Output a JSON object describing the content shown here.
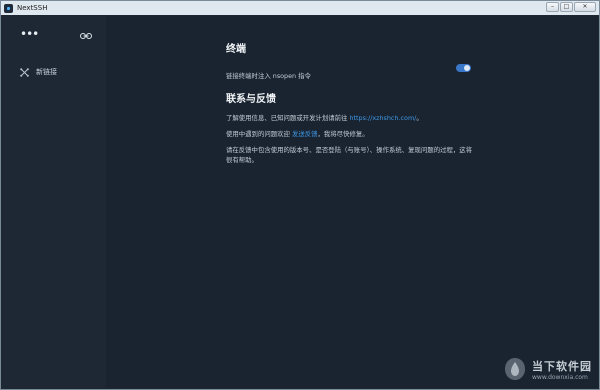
{
  "window": {
    "title": "NextSSH",
    "controls": {
      "minimize": "–",
      "maximize": "□",
      "close": "✕"
    }
  },
  "sidebar": {
    "menu_icon": "more-dots-icon",
    "link_icon": "link-toggle-icon",
    "new_connection_label": "新链接",
    "new_connection_icon": "network-icon"
  },
  "settings": {
    "terminal": {
      "title": "终端",
      "option_label": "链接终端时注入 nsopen 指令",
      "toggle_on": true
    },
    "feedback": {
      "title": "联系与反馈",
      "p1_text": "了解使用信息、已知问题或开发计划请前往 ",
      "p1_link": "https://xzhshch.com/",
      "p1_end": "。",
      "p2_text": "使用中遇到的问题欢迎 ",
      "p2_link": "发送反馈",
      "p2_end": "，我将尽快修复。",
      "p3_text": "请在反馈中包含使用的版本号、是否登陆（与账号）、操作系统、复现问题的过程，这将很有帮助。"
    }
  },
  "watermark": {
    "brand": "当下软件园",
    "url": "www.downxia.com"
  },
  "colors": {
    "accent": "#3d97e6",
    "background": "#1a2430",
    "sidebar": "#1e2834"
  }
}
